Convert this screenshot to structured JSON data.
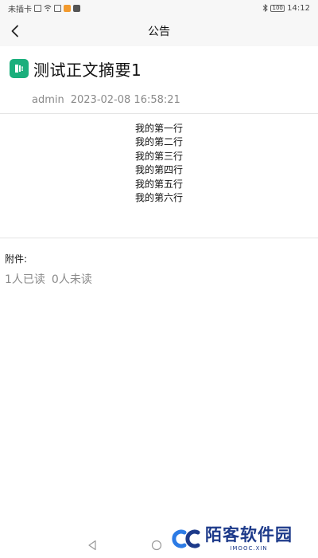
{
  "status_bar": {
    "carrier": "未插卡",
    "time": "14:12",
    "battery": "100"
  },
  "header": {
    "title": "公告"
  },
  "notice": {
    "title": "测试正文摘要1",
    "author": "admin",
    "datetime": "2023-02-08 16:58:21",
    "body_lines": [
      "我的第一行",
      "我的第二行",
      "我的第三行",
      "我的第四行",
      "我的第五行",
      "我的第六行"
    ],
    "attachments_label": "附件:",
    "read_count": "1人已读",
    "unread_count": "0人未读"
  },
  "watermark": {
    "name": "陌客软件园",
    "url": "IMOOC.XIN"
  },
  "colors": {
    "accent_green": "#1aaf7c",
    "meta_gray": "#8a8a8a",
    "watermark_blue": "#1d3a8a"
  }
}
